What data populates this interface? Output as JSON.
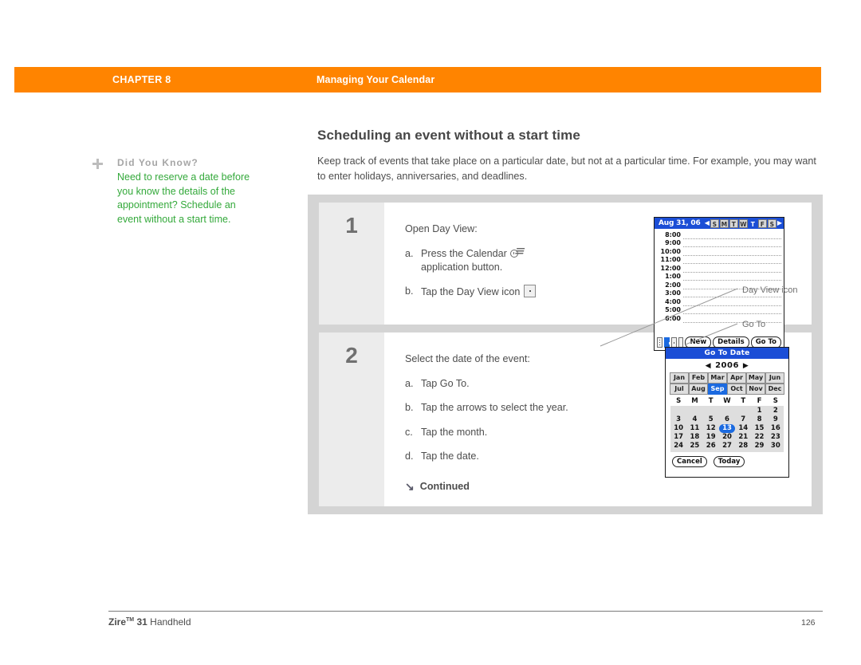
{
  "header": {
    "chapter_label": "CHAPTER 8",
    "chapter_title": "Managing Your Calendar",
    "accent_color": "#ff8400"
  },
  "sidebar": {
    "plus_icon": "plus-icon",
    "tip_heading": "Did You Know?",
    "tip_body": "Need to reserve a date before you know the details of the appointment? Schedule an event without a start time.",
    "heading_color": "#a6a6a6",
    "body_color": "#34a93b"
  },
  "main": {
    "title": "Scheduling an event without a start time",
    "intro": "Keep track of events that take place on a particular date, but not at a particular time. For example, you may want to enter holidays, anniversaries, and deadlines."
  },
  "steps": [
    {
      "number": "1",
      "lead": "Open Day View:",
      "substeps": [
        {
          "marker": "a.",
          "text": "Press the Calendar",
          "text_tail": "application button.",
          "icon": "calendar-app-button-icon"
        },
        {
          "marker": "b.",
          "text": "Tap the Day View icon",
          "icon": "day-view-icon"
        }
      ]
    },
    {
      "number": "2",
      "lead": "Select the date of the event:",
      "substeps": [
        {
          "marker": "a.",
          "text": "Tap Go To."
        },
        {
          "marker": "b.",
          "text": "Tap the arrows to select the year."
        },
        {
          "marker": "c.",
          "text": "Tap the month."
        },
        {
          "marker": "d.",
          "text": "Tap the date."
        }
      ],
      "continued": "Continued",
      "continued_arrow": "↘"
    }
  ],
  "day_view_screen": {
    "title_date": "Aug 31, 06",
    "prev_arrow": "◀",
    "next_arrow": "▶",
    "day_letters": [
      "S",
      "M",
      "T",
      "W",
      "T",
      "F",
      "S"
    ],
    "selected_day_index": 4,
    "times": [
      "8:00",
      "9:00",
      "10:00",
      "11:00",
      "12:00",
      "1:00",
      "2:00",
      "3:00",
      "4:00",
      "5:00",
      "6:00"
    ],
    "view_icons": [
      "agenda-view-icon",
      "day-view-icon",
      "week-view-icon",
      "month-view-icon"
    ],
    "selected_view_index": 1,
    "buttons": [
      "New",
      "Details",
      "Go To"
    ],
    "title_bar_color": "#1b4ed6"
  },
  "goto_date_screen": {
    "title": "Go To Date",
    "prev_arrow": "◀",
    "next_arrow": "▶",
    "year": "2006",
    "months": [
      [
        "Jan",
        "Feb",
        "Mar",
        "Apr",
        "May",
        "Jun"
      ],
      [
        "Jul",
        "Aug",
        "Sep",
        "Oct",
        "Nov",
        "Dec"
      ]
    ],
    "selected_month": "Sep",
    "day_headers": [
      "S",
      "M",
      "T",
      "W",
      "T",
      "F",
      "S"
    ],
    "weeks": [
      [
        "",
        "",
        "",
        "",
        "",
        "1",
        "2"
      ],
      [
        "3",
        "4",
        "5",
        "6",
        "7",
        "8",
        "9"
      ],
      [
        "10",
        "11",
        "12",
        "13",
        "14",
        "15",
        "16"
      ],
      [
        "17",
        "18",
        "19",
        "20",
        "21",
        "22",
        "23"
      ],
      [
        "24",
        "25",
        "26",
        "27",
        "28",
        "29",
        "30"
      ]
    ],
    "selected_date": "13",
    "buttons": [
      "Cancel",
      "Today"
    ],
    "title_bar_color": "#1b4ed6"
  },
  "callouts": [
    {
      "label": "Day View icon"
    },
    {
      "label": "Go To"
    }
  ],
  "footer": {
    "product_bold": "Zire",
    "trademark": "TM",
    "product_number": " 31",
    "product_suffix": " Handheld",
    "page_number": "126"
  }
}
